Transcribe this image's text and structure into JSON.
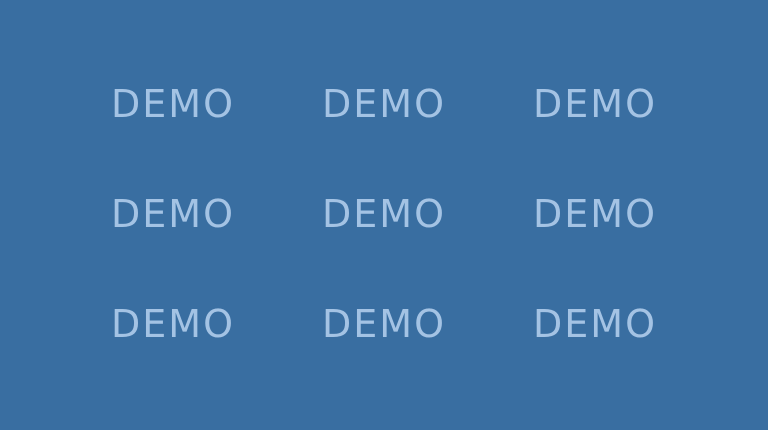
{
  "colors": {
    "background": "#396ea1",
    "text": "#a4c3e4"
  },
  "grid": {
    "rows": [
      [
        "DEMO",
        "DEMO",
        "DEMO"
      ],
      [
        "DEMO",
        "DEMO",
        "DEMO"
      ],
      [
        "DEMO",
        "DEMO",
        "DEMO"
      ]
    ]
  }
}
